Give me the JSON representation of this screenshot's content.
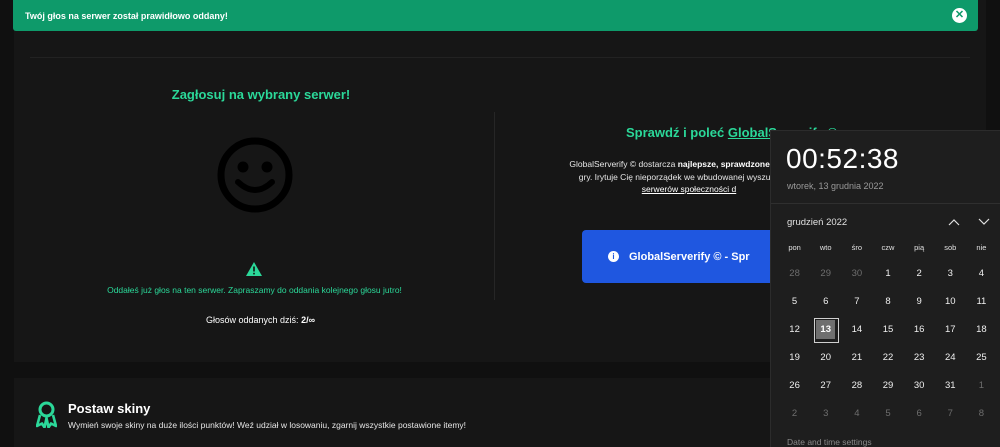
{
  "toast": {
    "message": "Twój głos na serwer został prawidłowo oddany!",
    "close_icon": "close-icon"
  },
  "vote": {
    "title": "Zagłosuj na wybrany serwer!",
    "icon": "smiley-face-icon",
    "warning_icon": "warning-triangle-icon",
    "message": "Oddałeś już głos na ten serwer. Zapraszamy do oddania kolejnego głosu jutro!",
    "count_label": "Głosów oddanych dziś:",
    "count_value": "2/∞"
  },
  "promo": {
    "title_prefix": "Sprawdź i poleć ",
    "title_link": "GlobalServerify ©",
    "line1_prefix": "GlobalServerify © dostarcza ",
    "line1_bold": "najlepsze, sprawdzone, polskie i",
    "line2": "gry. Irytuje Cię nieporządek we wbudowanej wyszukiwarce",
    "line3_link": "serwerów społeczności d",
    "button_label": "GlobalServerify © - Spr",
    "button_icon": "info-icon"
  },
  "skins": {
    "icon": "award-ribbon-icon",
    "title": "Postaw skiny",
    "text": "Wymień swoje skiny na duże ilości punktów! Weź udział w losowaniu, zgarnij wszystkie postawione itemy!"
  },
  "calendar": {
    "clock": "00:52:38",
    "date": "wtorek, 13 grudnia 2022",
    "month": "grudzień 2022",
    "prev_icon": "chevron-up-icon",
    "next_icon": "chevron-down-icon",
    "weekdays": [
      "pon",
      "wto",
      "śro",
      "czw",
      "pią",
      "sob",
      "nie"
    ],
    "days": [
      {
        "d": "28",
        "muted": true
      },
      {
        "d": "29",
        "muted": true
      },
      {
        "d": "30",
        "muted": true
      },
      {
        "d": "1"
      },
      {
        "d": "2"
      },
      {
        "d": "3"
      },
      {
        "d": "4"
      },
      {
        "d": "5"
      },
      {
        "d": "6"
      },
      {
        "d": "7"
      },
      {
        "d": "8"
      },
      {
        "d": "9"
      },
      {
        "d": "10"
      },
      {
        "d": "11"
      },
      {
        "d": "12"
      },
      {
        "d": "13",
        "today": true
      },
      {
        "d": "14"
      },
      {
        "d": "15"
      },
      {
        "d": "16"
      },
      {
        "d": "17"
      },
      {
        "d": "18"
      },
      {
        "d": "19"
      },
      {
        "d": "20"
      },
      {
        "d": "21"
      },
      {
        "d": "22"
      },
      {
        "d": "23"
      },
      {
        "d": "24"
      },
      {
        "d": "25"
      },
      {
        "d": "26"
      },
      {
        "d": "27"
      },
      {
        "d": "28"
      },
      {
        "d": "29"
      },
      {
        "d": "30"
      },
      {
        "d": "31"
      },
      {
        "d": "1",
        "muted": true
      },
      {
        "d": "2",
        "muted": true
      },
      {
        "d": "3",
        "muted": true
      },
      {
        "d": "4",
        "muted": true
      },
      {
        "d": "5",
        "muted": true
      },
      {
        "d": "6",
        "muted": true
      },
      {
        "d": "7",
        "muted": true
      },
      {
        "d": "8",
        "muted": true
      }
    ],
    "settings_link": "Date and time settings"
  },
  "colors": {
    "accent_green": "#2bd899",
    "toast_green": "#0e9a6a",
    "button_blue": "#1f57e0",
    "background": "#101010"
  }
}
